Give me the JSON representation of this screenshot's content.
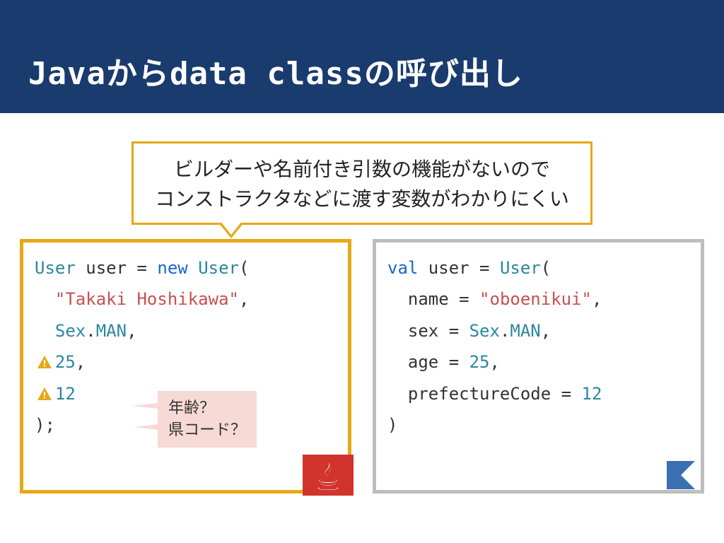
{
  "header": {
    "title": "Javaからdata classの呼び出し"
  },
  "callout": {
    "line1": "ビルダーや名前付き引数の機能がないので",
    "line2": "コンストラクタなどに渡す変数がわかりにくい"
  },
  "java_code": {
    "l1_type": "User",
    "l1_var": " user = ",
    "l1_new": "new",
    "l1_ctor": " User",
    "l1_open": "(",
    "l2_str": "\"Takaki Hoshikawa\"",
    "l2_comma": ",",
    "l3_enum": "Sex",
    "l3_dot": ".",
    "l3_member": "MAN",
    "l3_comma": ",",
    "l4_num": "25",
    "l4_comma": ",",
    "l5_num": "12",
    "l6_close": ");"
  },
  "bubble": {
    "line1": "年齢？",
    "line2": "県コード？"
  },
  "kotlin_code": {
    "l1_val": "val",
    "l1_rest": " user = ",
    "l1_type": "User",
    "l1_open": "(",
    "l2_name": "name = ",
    "l2_str": "\"oboenikui\"",
    "l2_comma": ",",
    "l3_name": "sex = ",
    "l3_enum": "Sex",
    "l3_dot": ".",
    "l3_member": "MAN",
    "l3_comma": ",",
    "l4_name": "age = ",
    "l4_num": "25",
    "l4_comma": ",",
    "l5_name": "prefectureCode = ",
    "l5_num": "12",
    "l6_close": ")"
  }
}
